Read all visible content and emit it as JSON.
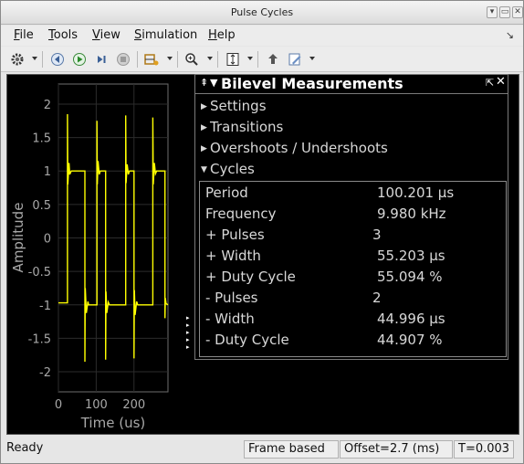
{
  "window": {
    "title": "Pulse Cycles",
    "buttons": [
      "▾",
      "▭",
      "✕"
    ]
  },
  "menu": {
    "items": [
      {
        "first": "F",
        "rest": "ile"
      },
      {
        "first": "T",
        "rest": "ools"
      },
      {
        "first": "V",
        "rest": "iew"
      },
      {
        "first": "S",
        "rest": "imulation"
      },
      {
        "first": "H",
        "rest": "elp"
      }
    ],
    "undock_icon": "undock-icon"
  },
  "toolbar": {
    "icons": [
      "gear-icon",
      "step-back-icon",
      "run-icon",
      "step-forward-icon",
      "stop-icon",
      "highlight-icon",
      "zoom-icon",
      "scale-axes-icon",
      "bring-to-front-icon",
      "edit-icon"
    ]
  },
  "plot": {
    "ylabel": "Amplitude",
    "xlabel": "Time (us)",
    "yticks": [
      "2",
      "1.5",
      "1",
      "0.5",
      "0",
      "-0.5",
      "-1",
      "-1.5",
      "-2"
    ],
    "xticks": [
      "0",
      "100",
      "200"
    ],
    "trace_color": "#ffff00"
  },
  "chart_data": {
    "type": "line",
    "xlabel": "Time (us)",
    "ylabel": "Amplitude",
    "xlim": [
      0,
      290
    ],
    "ylim": [
      -2.3,
      2.3
    ],
    "x": [
      0,
      24,
      24,
      25,
      28,
      30,
      34,
      70,
      70,
      71,
      74,
      78,
      80,
      102,
      102,
      103,
      105,
      108,
      111,
      125,
      125,
      126,
      128,
      132,
      135,
      178,
      178,
      179,
      182,
      185,
      188,
      200,
      200,
      201,
      203,
      207,
      210,
      250,
      250,
      251,
      254,
      257,
      260,
      282,
      282,
      283,
      285,
      290
    ],
    "y": [
      -0.97,
      -0.97,
      1.85,
      0.8,
      1.12,
      0.95,
      1.0,
      1.0,
      -1.85,
      -0.75,
      -1.12,
      -0.95,
      -1.0,
      -1.0,
      1.75,
      0.8,
      1.15,
      0.95,
      1.0,
      1.0,
      -1.82,
      -0.8,
      -1.12,
      -0.96,
      -1.0,
      -1.0,
      1.83,
      0.82,
      1.1,
      0.95,
      1.0,
      1.0,
      -1.8,
      -0.78,
      -1.15,
      -0.95,
      -1.0,
      -1.0,
      1.8,
      0.8,
      1.12,
      0.96,
      1.0,
      1.0,
      -1.2,
      -0.9,
      -0.98,
      -1.0
    ],
    "grid": true
  },
  "measurements": {
    "title": "Bilevel Measurements",
    "sections": [
      "Settings",
      "Transitions",
      "Overshoots / Undershoots",
      "Cycles"
    ],
    "rows": [
      {
        "label": "Period",
        "value": "100.201 µs"
      },
      {
        "label": "Frequency",
        "value": "9.980 kHz"
      },
      {
        "label": "+ Pulses",
        "value": "3"
      },
      {
        "label": "+ Width",
        "value": "55.203 µs"
      },
      {
        "label": "+ Duty Cycle",
        "value": "55.094 %"
      },
      {
        "label": "- Pulses",
        "value": "2"
      },
      {
        "label": "- Width",
        "value": "44.996 µs"
      },
      {
        "label": "- Duty Cycle",
        "value": "44.907 %"
      }
    ]
  },
  "status": {
    "ready": "Ready",
    "mode": "Frame based",
    "offset": "Offset=2.7 (ms)",
    "time": "T=0.003"
  }
}
